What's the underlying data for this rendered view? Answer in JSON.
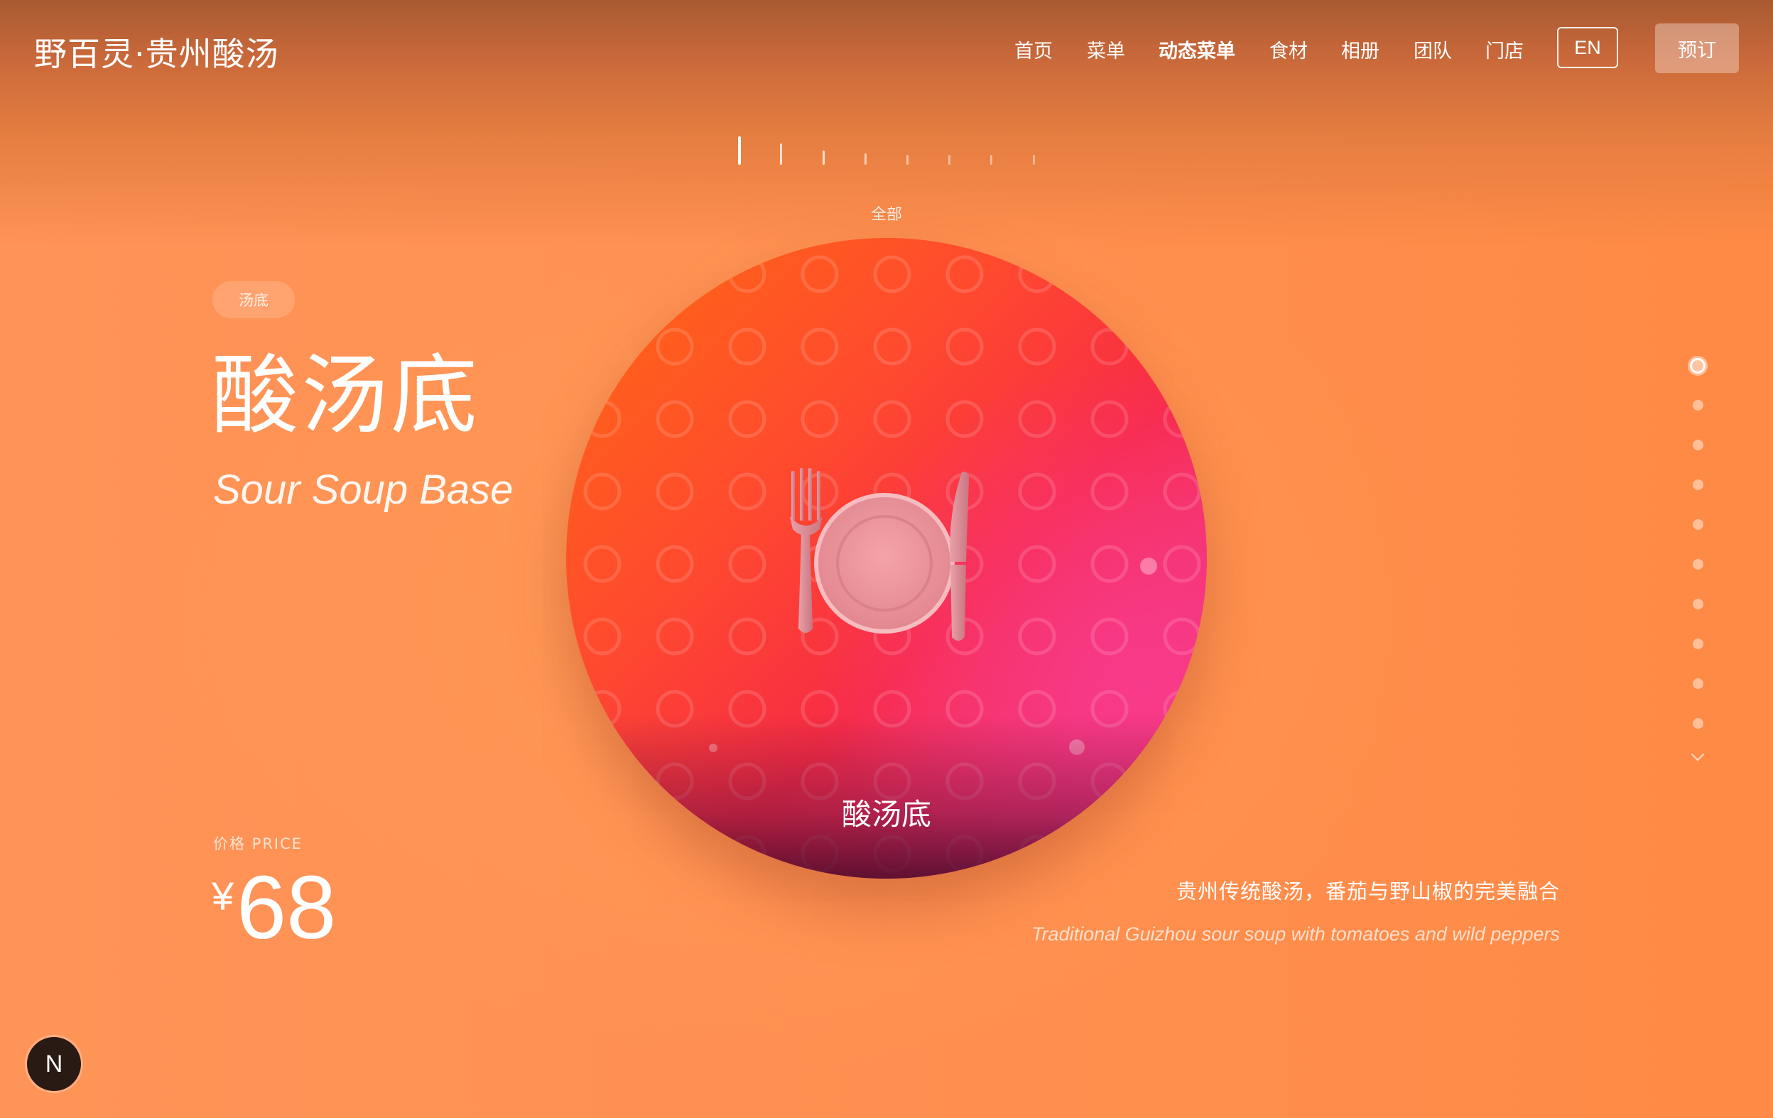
{
  "brand": "野百灵·贵州酸汤",
  "nav": {
    "items": [
      {
        "label": "首页",
        "active": false
      },
      {
        "label": "菜单",
        "active": false
      },
      {
        "label": "动态菜单",
        "active": true
      },
      {
        "label": "食材",
        "active": false
      },
      {
        "label": "相册",
        "active": false
      },
      {
        "label": "团队",
        "active": false
      },
      {
        "label": "门店",
        "active": false
      }
    ],
    "lang_label": "EN",
    "book_label": "预订"
  },
  "category_ticks": {
    "count": 8,
    "active_index": 0
  },
  "category_label": "全部",
  "dish": {
    "tag": "汤底",
    "name_zh": "酸汤底",
    "name_en": "Sour Soup Base",
    "price_label": "价格 PRICE",
    "currency": "¥",
    "price": "68",
    "icon": "fork-knife-plate-icon",
    "disc_label": "酸汤底",
    "desc_zh": "贵州传统酸汤，番茄与野山椒的完美融合",
    "desc_en": "Traditional Guizhou sour soup with tomatoes and wild peppers"
  },
  "pager": {
    "count": 10,
    "active_index": 0
  },
  "badge_letter": "N",
  "colors": {
    "accent_orange": "#ff8c45",
    "disc_start": "#ff6a12",
    "disc_mid": "#f72b45",
    "disc_end": "#f2357a",
    "badge_bg": "#2a1a14"
  }
}
